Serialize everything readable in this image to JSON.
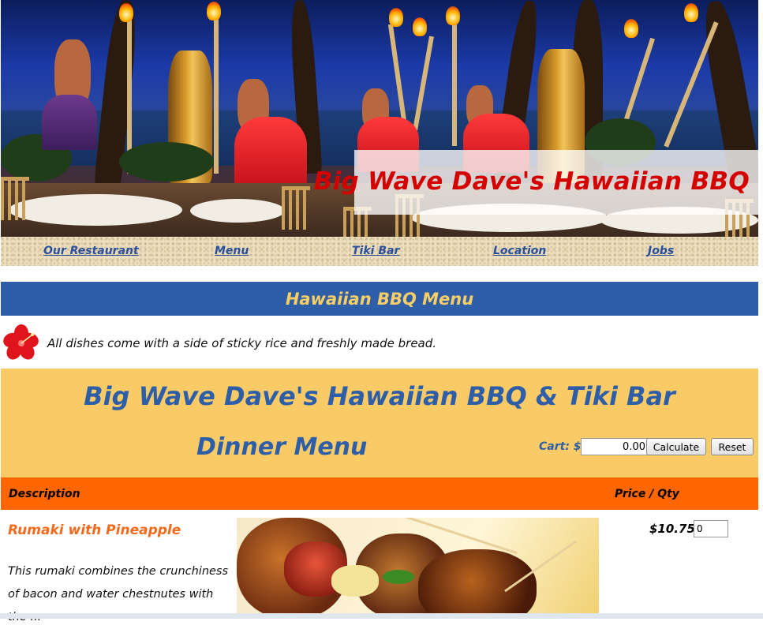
{
  "header": {
    "site_title": "Big Wave Dave's Hawaiian BBQ"
  },
  "nav": {
    "items": [
      {
        "label": "Our Restaurant"
      },
      {
        "label": "Menu"
      },
      {
        "label": "Tiki Bar"
      },
      {
        "label": "Location"
      },
      {
        "label": "Jobs"
      }
    ]
  },
  "banner": {
    "title": "Hawaiian BBQ Menu"
  },
  "note": {
    "text": "All dishes come with a side of sticky rice and freshly made bread."
  },
  "menu_header": {
    "restaurant_name": "Big Wave Dave's Hawaiian BBQ & Tiki Bar",
    "menu_title": "Dinner Menu",
    "cart_label": "Cart: $",
    "cart_value": "0.00",
    "calculate_label": "Calculate",
    "reset_label": "Reset"
  },
  "columns": {
    "description": "Description",
    "price_qty": "Price / Qty"
  },
  "items": [
    {
      "name": "Rumaki with Pineapple",
      "description": "This rumaki combines the crunchiness of bacon and water chestnutes with the ...",
      "price": "$10.75",
      "qty": "0"
    }
  ],
  "colors": {
    "banner_blue": "#2f5ea8",
    "banner_text_gold": "#f7cf66",
    "menu_header_yellow": "#f8cb66",
    "column_header_orange": "#ff6600",
    "title_red": "#d40000",
    "item_name_orange": "#f26a1b"
  },
  "icons": {
    "note_icon": "hibiscus-flower-icon"
  }
}
